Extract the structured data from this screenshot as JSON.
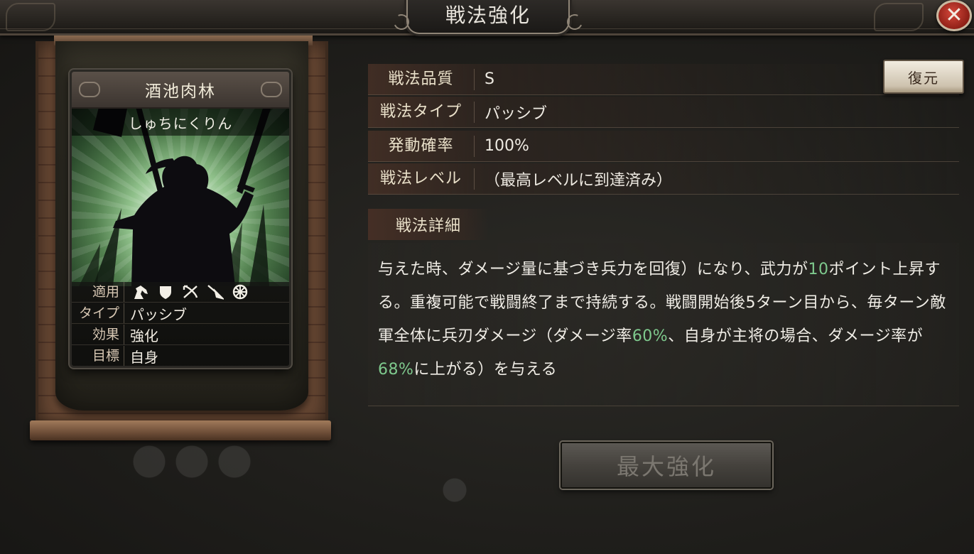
{
  "window": {
    "title": "戦法強化",
    "close_symbol": "✕"
  },
  "card": {
    "name": "酒池肉林",
    "reading": "しゅちにくりん",
    "rows": {
      "apply_label": "適用",
      "apply_icons": [
        "cavalry-icon",
        "shield-icon",
        "bow-icon",
        "spear-icon",
        "wheel-icon"
      ],
      "type_label": "タイプ",
      "type_value": "パッシブ",
      "effect_label": "効果",
      "effect_value": "強化",
      "target_label": "目標",
      "target_value": "自身"
    }
  },
  "properties": [
    {
      "label": "戦法品質",
      "value": "S"
    },
    {
      "label": "戦法タイプ",
      "value": "パッシブ"
    },
    {
      "label": "発動確率",
      "value": "100%"
    },
    {
      "label": "戦法レベル",
      "value": "（最高レベルに到達済み）"
    }
  ],
  "reset_button": "復元",
  "detail": {
    "heading": "戦法詳細",
    "segments": [
      {
        "text": "与えた時、ダメージ量に基づき兵力を回復）になり、武力が",
        "hl": false
      },
      {
        "text": "10",
        "hl": true
      },
      {
        "text": "ポイント上昇する。重複可能で戦闘終了まで持続する。戦闘開始後5ターン目から、毎ターン敵軍全体に兵刃ダメージ（ダメージ率",
        "hl": false
      },
      {
        "text": "60%",
        "hl": true
      },
      {
        "text": "、自身が主将の場合、ダメージ率が",
        "hl": false
      },
      {
        "text": "68%",
        "hl": true
      },
      {
        "text": "に上がる）を与える",
        "hl": false
      }
    ],
    "highlight_color": "#7ec98d"
  },
  "max_button": "最大強化"
}
